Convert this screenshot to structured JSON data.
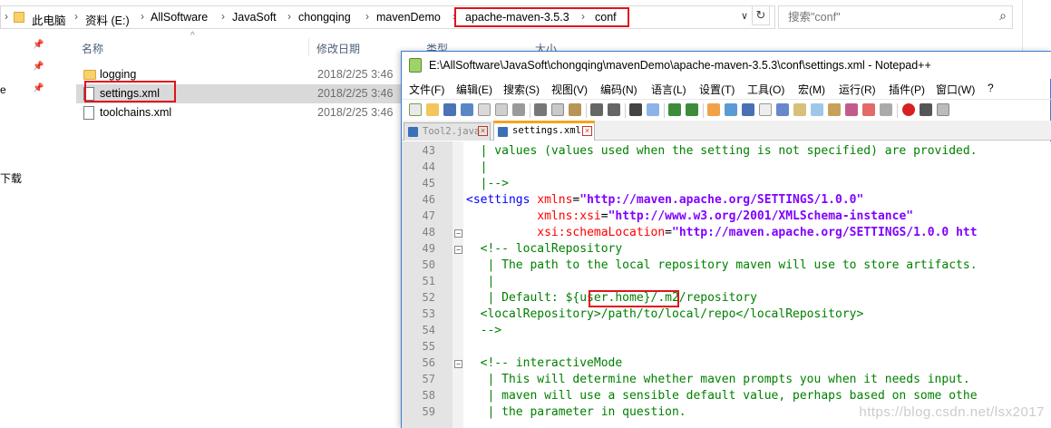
{
  "explorer": {
    "breadcrumbs": [
      "此电脑",
      "资料 (E:)",
      "AllSoftware",
      "JavaSoft",
      "chongqing",
      "mavenDemo",
      "apache-maven-3.5.3",
      "conf"
    ],
    "search_placeholder": "搜索\"conf\"",
    "nav_items": [
      "e",
      "下载"
    ],
    "columns": [
      "名称",
      "修改日期",
      "类型",
      "大小"
    ],
    "files": [
      {
        "name": "logging",
        "kind": "folder",
        "date": "",
        "selected": false
      },
      {
        "name": "settings.xml",
        "kind": "file",
        "date": "2018/2/25 3:46",
        "selected": true
      },
      {
        "name": "toolchains.xml",
        "kind": "file",
        "date": "2018/2/25 3:46",
        "selected": false
      }
    ],
    "logging_date": "2018/2/25 3:46",
    "highlight_color": "#e0131b"
  },
  "npp": {
    "title": "E:\\AllSoftware\\JavaSoft\\chongqing\\mavenDemo\\apache-maven-3.5.3\\conf\\settings.xml - Notepad++",
    "menus": [
      "文件(F)",
      "编辑(E)",
      "搜索(S)",
      "视图(V)",
      "编码(N)",
      "语言(L)",
      "设置(T)",
      "工具(O)",
      "宏(M)",
      "运行(R)",
      "插件(P)",
      "窗口(W)",
      "?"
    ],
    "tabs": [
      {
        "label": "Tool2.java",
        "active": false
      },
      {
        "label": "settings.xml",
        "active": true
      }
    ],
    "lines": [
      {
        "n": "43",
        "fold": "",
        "parts": [
          {
            "c": "c-comment",
            "t": "  | values (values used when the setting is not specified) are provided."
          }
        ]
      },
      {
        "n": "44",
        "fold": "",
        "parts": [
          {
            "c": "c-comment",
            "t": "  |"
          }
        ]
      },
      {
        "n": "45",
        "fold": "",
        "parts": [
          {
            "c": "c-comment",
            "t": "  |-->"
          }
        ]
      },
      {
        "n": "46",
        "fold": "",
        "parts": [
          {
            "c": "c-tag",
            "t": "<settings "
          },
          {
            "c": "c-attr",
            "t": "xmlns"
          },
          {
            "c": "c-eq",
            "t": "="
          },
          {
            "c": "c-str",
            "t": "\"http://maven.apache.org/SETTINGS/1.0.0\""
          }
        ]
      },
      {
        "n": "47",
        "fold": "",
        "parts": [
          {
            "c": "c-text",
            "t": "          "
          },
          {
            "c": "c-attr",
            "t": "xmlns:xsi"
          },
          {
            "c": "c-eq",
            "t": "="
          },
          {
            "c": "c-str",
            "t": "\"http://www.w3.org/2001/XMLSchema-instance\""
          }
        ]
      },
      {
        "n": "48",
        "fold": "minus",
        "parts": [
          {
            "c": "c-text",
            "t": "          "
          },
          {
            "c": "c-attr",
            "t": "xsi:schemaLocation"
          },
          {
            "c": "c-eq",
            "t": "="
          },
          {
            "c": "c-str",
            "t": "\"http://maven.apache.org/SETTINGS/1.0.0 htt"
          }
        ]
      },
      {
        "n": "49",
        "fold": "minus",
        "parts": [
          {
            "c": "c-comment",
            "t": "  <!-- localRepository"
          }
        ]
      },
      {
        "n": "50",
        "fold": "",
        "parts": [
          {
            "c": "c-comment",
            "t": "   | The path to the local repository maven will use to store artifacts."
          }
        ]
      },
      {
        "n": "51",
        "fold": "",
        "parts": [
          {
            "c": "c-comment",
            "t": "   |"
          }
        ]
      },
      {
        "n": "52",
        "fold": "",
        "parts": [
          {
            "c": "c-comment",
            "t": "   | Default: ${user.home}/.m2/repository"
          }
        ]
      },
      {
        "n": "53",
        "fold": "",
        "parts": [
          {
            "c": "c-comment",
            "t": "  <localRepository>/path/to/local/repo</localRepository>"
          }
        ]
      },
      {
        "n": "54",
        "fold": "",
        "parts": [
          {
            "c": "c-comment",
            "t": "  -->"
          }
        ]
      },
      {
        "n": "55",
        "fold": "",
        "parts": [
          {
            "c": "c-text",
            "t": ""
          }
        ]
      },
      {
        "n": "56",
        "fold": "minus",
        "parts": [
          {
            "c": "c-comment",
            "t": "  <!-- interactiveMode"
          }
        ]
      },
      {
        "n": "57",
        "fold": "",
        "parts": [
          {
            "c": "c-comment",
            "t": "   | This will determine whether maven prompts you when it needs input."
          }
        ]
      },
      {
        "n": "58",
        "fold": "",
        "parts": [
          {
            "c": "c-comment",
            "t": "   | maven will use a sensible default value, perhaps based on some othe"
          }
        ]
      },
      {
        "n": "59",
        "fold": "",
        "parts": [
          {
            "c": "c-comment",
            "t": "   | the parameter in question."
          }
        ]
      }
    ],
    "watermark": "https://blog.csdn.net/lsx2017"
  }
}
